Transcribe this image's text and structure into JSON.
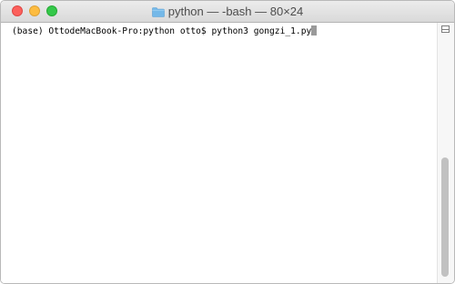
{
  "window": {
    "title": "python — -bash — 80×24",
    "folder_icon": "folder-icon",
    "accent_colors": {
      "close": "#fc605c",
      "minimize": "#fdbc40",
      "zoom": "#34c84a"
    }
  },
  "terminal": {
    "prompt": "(base) OttodeMacBook-Pro:python otto$ ",
    "command": "python3 gongzi_1.py"
  },
  "scrollbar": {
    "split_icon": "split-pane-icon"
  }
}
